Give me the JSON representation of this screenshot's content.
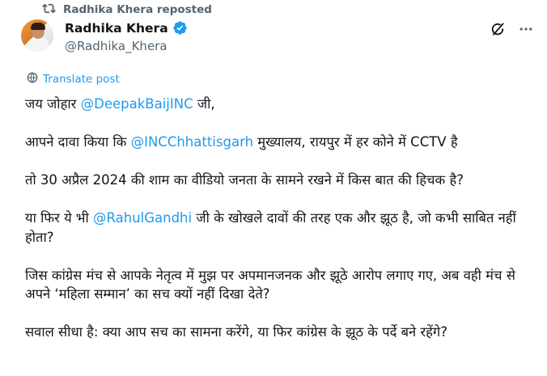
{
  "repost": {
    "label": "Radhika Khera reposted",
    "icon": "repost-icon"
  },
  "author": {
    "display_name": "Radhika Khera",
    "handle": "@Radhika_Khera",
    "verified_color": "#1d9bf0"
  },
  "translate_label": "Translate post",
  "post": {
    "p1": {
      "a": "जय जोहार ",
      "mention": "@DeepakBaijINC",
      "b": " जी,"
    },
    "p2": {
      "a": "आपने दावा किया कि ",
      "mention": "@INCChhattisgarh",
      "b": " मुख्यालय, रायपुर में हर कोने में CCTV है"
    },
    "p3": "तो 30 अप्रैल 2024 की शाम का वीडियो जनता के सामने रखने में किस बात की हिचक है?",
    "p4": {
      "a": "या फिर ये भी ",
      "mention": "@RahulGandhi",
      "b": " जी के खोखले दावों की तरह एक और झूठ है, जो कभी साबित नहीं होता?"
    },
    "p5": "जिस कांग्रेस मंच से आपके नेतृत्व में मुझ पर अपमानजनक और झूठे आरोप लगाए गए, अब वही मंच से अपने ‘महिला सम्मान’ का सच क्यों नहीं दिखा देते?",
    "p6": "सवाल सीधा है: क्या आप सच का सामना करेंगे, या फिर कांग्रेस के झूठ के पर्दे बने रहेंगे?"
  },
  "colors": {
    "link": "#1d9bf0",
    "secondary": "#536471",
    "text": "#0f1419"
  }
}
